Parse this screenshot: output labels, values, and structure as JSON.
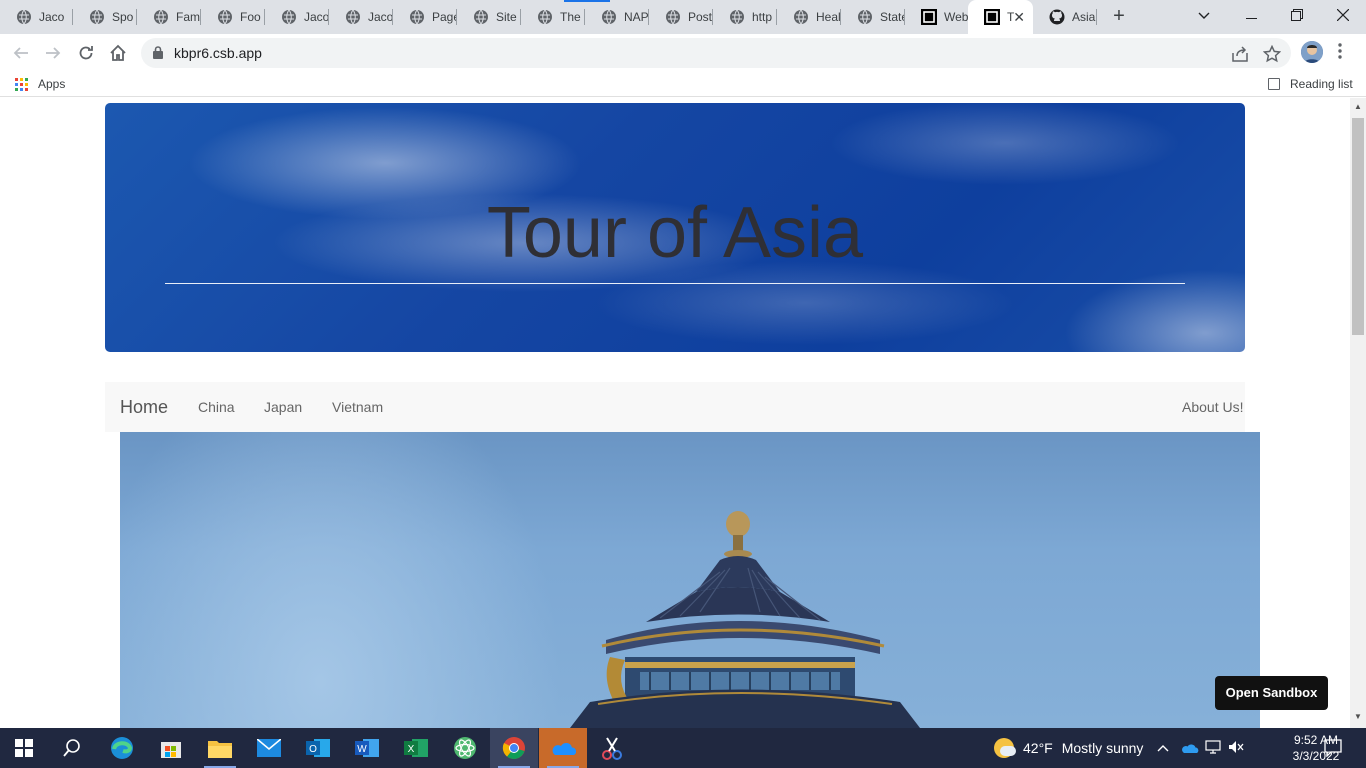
{
  "browser": {
    "tabs": [
      {
        "title": "Jaco",
        "icon": "globe-icon"
      },
      {
        "title": "Spo",
        "icon": "globe-icon"
      },
      {
        "title": "Fam",
        "icon": "globe-icon"
      },
      {
        "title": "Foo",
        "icon": "globe-icon"
      },
      {
        "title": "Jaco",
        "icon": "globe-icon"
      },
      {
        "title": "Jaco",
        "icon": "globe-icon"
      },
      {
        "title": "Page",
        "icon": "globe-icon"
      },
      {
        "title": "Site",
        "icon": "globe-icon"
      },
      {
        "title": "The",
        "icon": "globe-icon"
      },
      {
        "title": "NAP",
        "icon": "globe-icon"
      },
      {
        "title": "Post",
        "icon": "globe-icon"
      },
      {
        "title": "http",
        "icon": "globe-icon"
      },
      {
        "title": "Heal",
        "icon": "globe-icon"
      },
      {
        "title": "State",
        "icon": "globe-icon"
      },
      {
        "title": "Web",
        "icon": "codesandbox-icon"
      },
      {
        "title": "T",
        "icon": "codesandbox-icon",
        "active": true
      },
      {
        "title": "Asia",
        "icon": "github-icon"
      }
    ],
    "address": "kbpr6.csb.app",
    "bookmarks": {
      "apps_label": "Apps",
      "reading_list_label": "Reading list"
    }
  },
  "page": {
    "jumbotron_title": "Tour of Asia",
    "nav": {
      "brand": "Home",
      "links": [
        "China",
        "Japan",
        "Vietnam"
      ],
      "right_link": "About Us!"
    },
    "open_sandbox_label": "Open Sandbox"
  },
  "taskbar": {
    "apps": [
      "start-icon",
      "search-icon",
      "edge-icon",
      "store-icon",
      "file-explorer-icon",
      "mail-icon",
      "outlook-icon",
      "word-icon",
      "excel-icon",
      "atom-icon",
      "chrome-icon",
      "onedrive-icon",
      "snip-icon"
    ],
    "weather": {
      "temp": "42°F",
      "condition": "Mostly sunny"
    },
    "time": "9:52 AM",
    "date": "3/3/2022"
  },
  "colors": {
    "accent": "#1a73e8",
    "taskbar": "#202840",
    "jumbotron_sky": "#1546a3",
    "navbar_bg": "#f8f8f8"
  }
}
